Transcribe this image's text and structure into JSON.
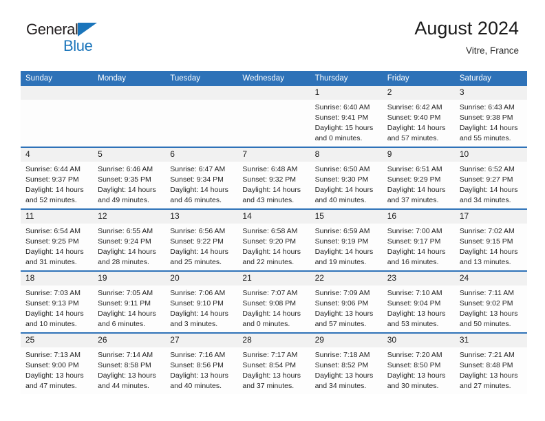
{
  "brand": {
    "name_top": "General",
    "name_bottom": "Blue",
    "logo_icon": "triangle-logo-icon",
    "accent_color": "#1b75bb"
  },
  "header": {
    "title": "August 2024",
    "subtitle": "Vitre, France"
  },
  "theme": {
    "header_blue": "#2e72b8",
    "daynum_gray": "#f1f1f1",
    "cell_white": "#fdfdfd"
  },
  "calendar": {
    "weekday_headers": [
      "Sunday",
      "Monday",
      "Tuesday",
      "Wednesday",
      "Thursday",
      "Friday",
      "Saturday"
    ],
    "weeks": [
      [
        {
          "day": "",
          "sunrise": "",
          "sunset": "",
          "daylight_line1": "",
          "daylight_line2": ""
        },
        {
          "day": "",
          "sunrise": "",
          "sunset": "",
          "daylight_line1": "",
          "daylight_line2": ""
        },
        {
          "day": "",
          "sunrise": "",
          "sunset": "",
          "daylight_line1": "",
          "daylight_line2": ""
        },
        {
          "day": "",
          "sunrise": "",
          "sunset": "",
          "daylight_line1": "",
          "daylight_line2": ""
        },
        {
          "day": "1",
          "sunrise": "Sunrise: 6:40 AM",
          "sunset": "Sunset: 9:41 PM",
          "daylight_line1": "Daylight: 15 hours",
          "daylight_line2": "and 0 minutes."
        },
        {
          "day": "2",
          "sunrise": "Sunrise: 6:42 AM",
          "sunset": "Sunset: 9:40 PM",
          "daylight_line1": "Daylight: 14 hours",
          "daylight_line2": "and 57 minutes."
        },
        {
          "day": "3",
          "sunrise": "Sunrise: 6:43 AM",
          "sunset": "Sunset: 9:38 PM",
          "daylight_line1": "Daylight: 14 hours",
          "daylight_line2": "and 55 minutes."
        }
      ],
      [
        {
          "day": "4",
          "sunrise": "Sunrise: 6:44 AM",
          "sunset": "Sunset: 9:37 PM",
          "daylight_line1": "Daylight: 14 hours",
          "daylight_line2": "and 52 minutes."
        },
        {
          "day": "5",
          "sunrise": "Sunrise: 6:46 AM",
          "sunset": "Sunset: 9:35 PM",
          "daylight_line1": "Daylight: 14 hours",
          "daylight_line2": "and 49 minutes."
        },
        {
          "day": "6",
          "sunrise": "Sunrise: 6:47 AM",
          "sunset": "Sunset: 9:34 PM",
          "daylight_line1": "Daylight: 14 hours",
          "daylight_line2": "and 46 minutes."
        },
        {
          "day": "7",
          "sunrise": "Sunrise: 6:48 AM",
          "sunset": "Sunset: 9:32 PM",
          "daylight_line1": "Daylight: 14 hours",
          "daylight_line2": "and 43 minutes."
        },
        {
          "day": "8",
          "sunrise": "Sunrise: 6:50 AM",
          "sunset": "Sunset: 9:30 PM",
          "daylight_line1": "Daylight: 14 hours",
          "daylight_line2": "and 40 minutes."
        },
        {
          "day": "9",
          "sunrise": "Sunrise: 6:51 AM",
          "sunset": "Sunset: 9:29 PM",
          "daylight_line1": "Daylight: 14 hours",
          "daylight_line2": "and 37 minutes."
        },
        {
          "day": "10",
          "sunrise": "Sunrise: 6:52 AM",
          "sunset": "Sunset: 9:27 PM",
          "daylight_line1": "Daylight: 14 hours",
          "daylight_line2": "and 34 minutes."
        }
      ],
      [
        {
          "day": "11",
          "sunrise": "Sunrise: 6:54 AM",
          "sunset": "Sunset: 9:25 PM",
          "daylight_line1": "Daylight: 14 hours",
          "daylight_line2": "and 31 minutes."
        },
        {
          "day": "12",
          "sunrise": "Sunrise: 6:55 AM",
          "sunset": "Sunset: 9:24 PM",
          "daylight_line1": "Daylight: 14 hours",
          "daylight_line2": "and 28 minutes."
        },
        {
          "day": "13",
          "sunrise": "Sunrise: 6:56 AM",
          "sunset": "Sunset: 9:22 PM",
          "daylight_line1": "Daylight: 14 hours",
          "daylight_line2": "and 25 minutes."
        },
        {
          "day": "14",
          "sunrise": "Sunrise: 6:58 AM",
          "sunset": "Sunset: 9:20 PM",
          "daylight_line1": "Daylight: 14 hours",
          "daylight_line2": "and 22 minutes."
        },
        {
          "day": "15",
          "sunrise": "Sunrise: 6:59 AM",
          "sunset": "Sunset: 9:19 PM",
          "daylight_line1": "Daylight: 14 hours",
          "daylight_line2": "and 19 minutes."
        },
        {
          "day": "16",
          "sunrise": "Sunrise: 7:00 AM",
          "sunset": "Sunset: 9:17 PM",
          "daylight_line1": "Daylight: 14 hours",
          "daylight_line2": "and 16 minutes."
        },
        {
          "day": "17",
          "sunrise": "Sunrise: 7:02 AM",
          "sunset": "Sunset: 9:15 PM",
          "daylight_line1": "Daylight: 14 hours",
          "daylight_line2": "and 13 minutes."
        }
      ],
      [
        {
          "day": "18",
          "sunrise": "Sunrise: 7:03 AM",
          "sunset": "Sunset: 9:13 PM",
          "daylight_line1": "Daylight: 14 hours",
          "daylight_line2": "and 10 minutes."
        },
        {
          "day": "19",
          "sunrise": "Sunrise: 7:05 AM",
          "sunset": "Sunset: 9:11 PM",
          "daylight_line1": "Daylight: 14 hours",
          "daylight_line2": "and 6 minutes."
        },
        {
          "day": "20",
          "sunrise": "Sunrise: 7:06 AM",
          "sunset": "Sunset: 9:10 PM",
          "daylight_line1": "Daylight: 14 hours",
          "daylight_line2": "and 3 minutes."
        },
        {
          "day": "21",
          "sunrise": "Sunrise: 7:07 AM",
          "sunset": "Sunset: 9:08 PM",
          "daylight_line1": "Daylight: 14 hours",
          "daylight_line2": "and 0 minutes."
        },
        {
          "day": "22",
          "sunrise": "Sunrise: 7:09 AM",
          "sunset": "Sunset: 9:06 PM",
          "daylight_line1": "Daylight: 13 hours",
          "daylight_line2": "and 57 minutes."
        },
        {
          "day": "23",
          "sunrise": "Sunrise: 7:10 AM",
          "sunset": "Sunset: 9:04 PM",
          "daylight_line1": "Daylight: 13 hours",
          "daylight_line2": "and 53 minutes."
        },
        {
          "day": "24",
          "sunrise": "Sunrise: 7:11 AM",
          "sunset": "Sunset: 9:02 PM",
          "daylight_line1": "Daylight: 13 hours",
          "daylight_line2": "and 50 minutes."
        }
      ],
      [
        {
          "day": "25",
          "sunrise": "Sunrise: 7:13 AM",
          "sunset": "Sunset: 9:00 PM",
          "daylight_line1": "Daylight: 13 hours",
          "daylight_line2": "and 47 minutes."
        },
        {
          "day": "26",
          "sunrise": "Sunrise: 7:14 AM",
          "sunset": "Sunset: 8:58 PM",
          "daylight_line1": "Daylight: 13 hours",
          "daylight_line2": "and 44 minutes."
        },
        {
          "day": "27",
          "sunrise": "Sunrise: 7:16 AM",
          "sunset": "Sunset: 8:56 PM",
          "daylight_line1": "Daylight: 13 hours",
          "daylight_line2": "and 40 minutes."
        },
        {
          "day": "28",
          "sunrise": "Sunrise: 7:17 AM",
          "sunset": "Sunset: 8:54 PM",
          "daylight_line1": "Daylight: 13 hours",
          "daylight_line2": "and 37 minutes."
        },
        {
          "day": "29",
          "sunrise": "Sunrise: 7:18 AM",
          "sunset": "Sunset: 8:52 PM",
          "daylight_line1": "Daylight: 13 hours",
          "daylight_line2": "and 34 minutes."
        },
        {
          "day": "30",
          "sunrise": "Sunrise: 7:20 AM",
          "sunset": "Sunset: 8:50 PM",
          "daylight_line1": "Daylight: 13 hours",
          "daylight_line2": "and 30 minutes."
        },
        {
          "day": "31",
          "sunrise": "Sunrise: 7:21 AM",
          "sunset": "Sunset: 8:48 PM",
          "daylight_line1": "Daylight: 13 hours",
          "daylight_line2": "and 27 minutes."
        }
      ]
    ]
  }
}
